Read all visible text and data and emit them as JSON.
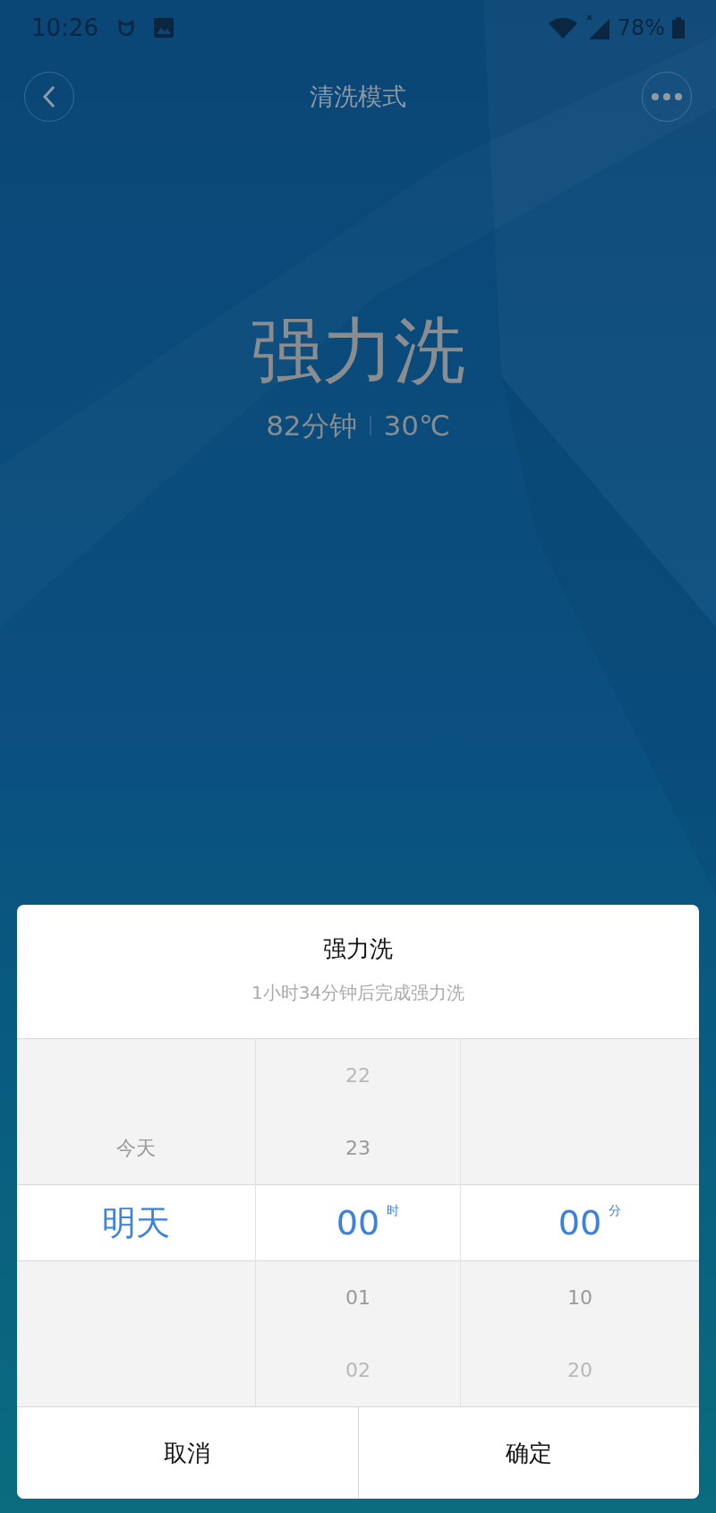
{
  "status_bar": {
    "time": "10:26",
    "battery": "78%"
  },
  "header": {
    "title": "清洗模式"
  },
  "mode": {
    "name": "强力洗",
    "duration": "82分钟",
    "temperature": "30℃"
  },
  "dialog": {
    "title": "强力洗",
    "subtitle": "1小时34分钟后完成强力洗",
    "columns": [
      {
        "above": [
          "今天"
        ],
        "value": "明天"
      },
      {
        "above": [
          "22",
          "23"
        ],
        "value": "00",
        "unit": "时",
        "below": [
          "01",
          "02"
        ]
      },
      {
        "value": "00",
        "unit": "分",
        "below": [
          "10",
          "20"
        ]
      }
    ],
    "buttons": [
      "取消",
      "确定"
    ]
  }
}
